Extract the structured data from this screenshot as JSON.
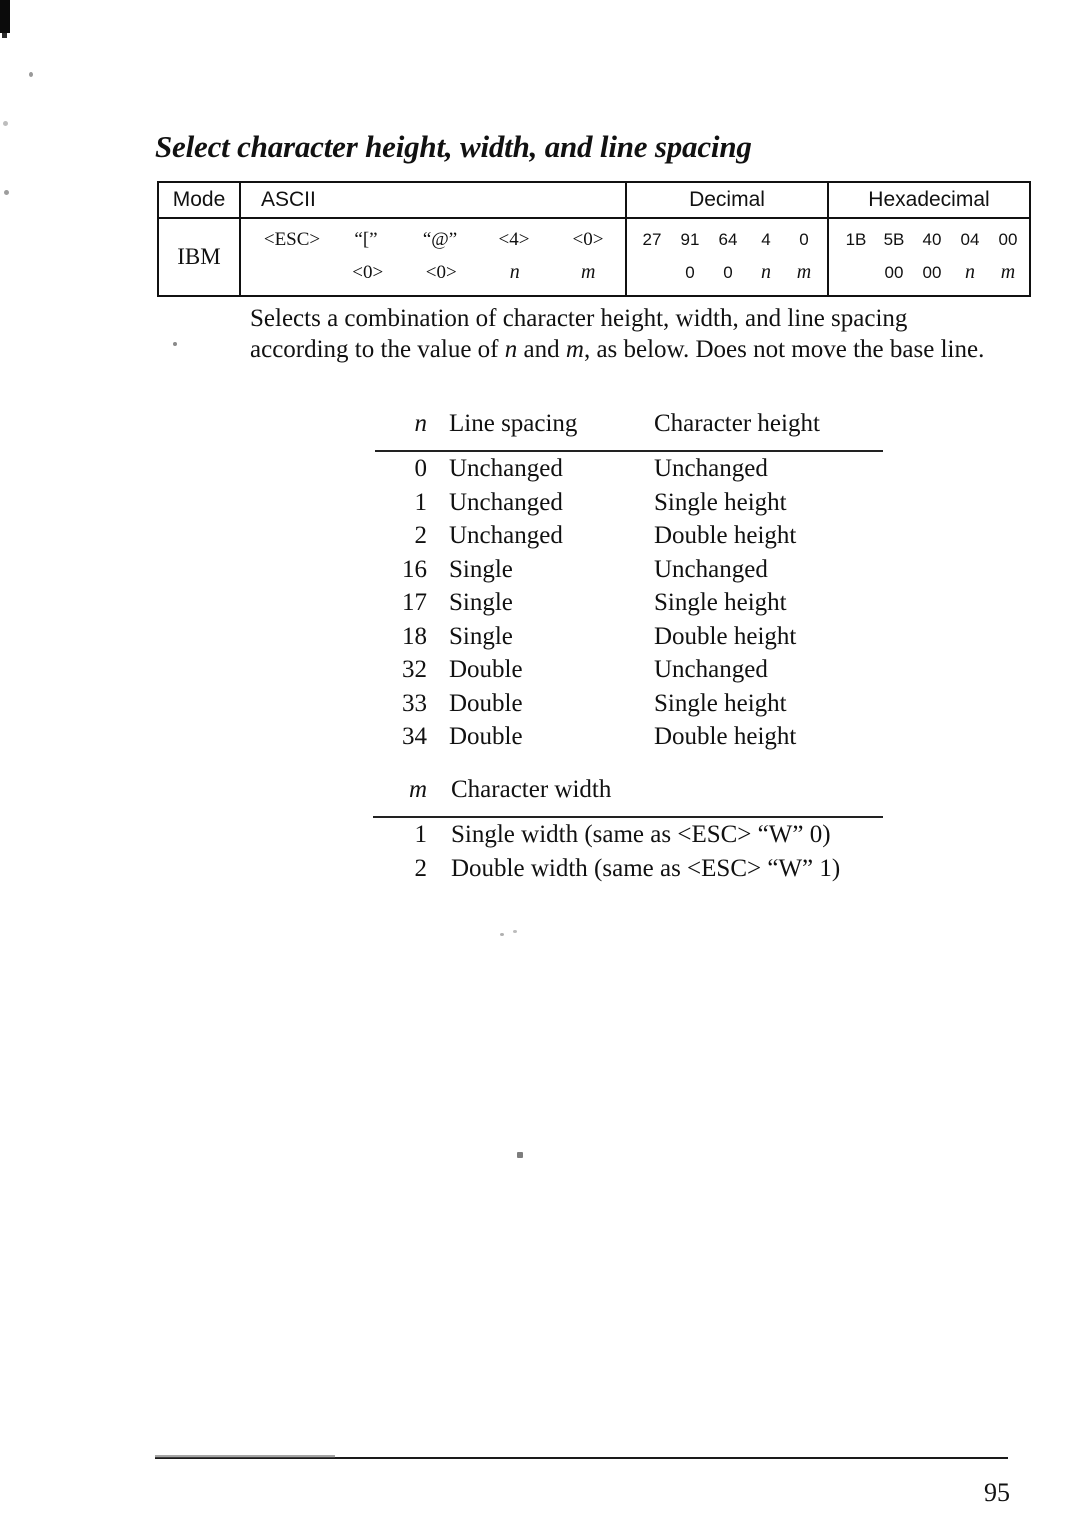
{
  "document": {
    "title": "Select character height, width, and line spacing",
    "page_number": "95"
  },
  "command_table": {
    "headers": {
      "mode": "Mode",
      "ascii": "ASCII",
      "decimal": "Decimal",
      "hexadecimal": "Hexadecimal"
    },
    "row": {
      "mode": "IBM",
      "ascii_line1": [
        "<ESC>",
        "“[”",
        "“@”",
        "<4>",
        "<0>"
      ],
      "ascii_line2": [
        "<0>",
        "<0>",
        "n",
        "m"
      ],
      "decimal_line1": [
        "27",
        "91",
        "64",
        "4",
        "0"
      ],
      "decimal_line2": [
        "0",
        "0",
        "n",
        "m"
      ],
      "hex_line1": [
        "1B",
        "5B",
        "40",
        "04",
        "00"
      ],
      "hex_line2": [
        "00",
        "00",
        "n",
        "m"
      ]
    }
  },
  "description": {
    "line1": "Selects a combination of character height, width, and line spacing",
    "line2_a": "according to the value of ",
    "line2_n": "n",
    "line2_b": " and ",
    "line2_m": "m",
    "line2_c": ", as below. Does not move the base",
    "line3": "line."
  },
  "n_table": {
    "headers": {
      "key": "n",
      "col2": "Line spacing",
      "col3": "Character height"
    },
    "rows": [
      {
        "n": "0",
        "spacing": "Unchanged",
        "height": "Unchanged"
      },
      {
        "n": "1",
        "spacing": "Unchanged",
        "height": "Single height"
      },
      {
        "n": "2",
        "spacing": "Unchanged",
        "height": "Double height"
      },
      {
        "n": "16",
        "spacing": "Single",
        "height": "Unchanged"
      },
      {
        "n": "17",
        "spacing": "Single",
        "height": "Single height"
      },
      {
        "n": "18",
        "spacing": "Single",
        "height": "Double height"
      },
      {
        "n": "32",
        "spacing": "Double",
        "height": "Unchanged"
      },
      {
        "n": "33",
        "spacing": "Double",
        "height": "Single height"
      },
      {
        "n": "34",
        "spacing": "Double",
        "height": "Double height"
      }
    ]
  },
  "m_table": {
    "headers": {
      "key": "m",
      "col2": "Character width"
    },
    "rows": [
      {
        "m": "1",
        "width": "Single width (same as <ESC> “W” 0)"
      },
      {
        "m": "2",
        "width": "Double width (same as <ESC> “W” 1)"
      }
    ]
  }
}
